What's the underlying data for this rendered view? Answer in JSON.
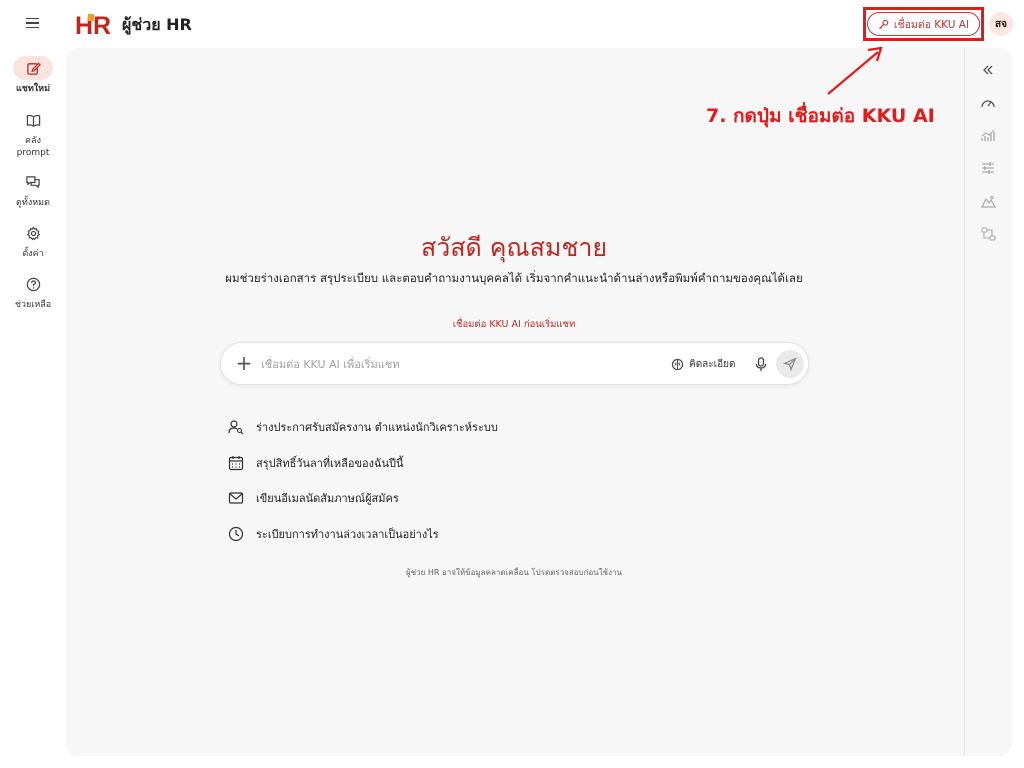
{
  "header": {
    "app_title": "ผู้ช่วย HR",
    "logo_text": "HR",
    "connect_button": "เชื่อมต่อ KKU AI",
    "avatar_initials": "สจ"
  },
  "sidebar": {
    "items": [
      {
        "label": "แชทใหม่",
        "icon": "edit-icon",
        "active": true
      },
      {
        "label": "คลัง prompt",
        "icon": "book-icon",
        "active": false
      },
      {
        "label": "ดูทั้งหมด",
        "icon": "chat-icon",
        "active": false
      },
      {
        "label": "ตั้งค่า",
        "icon": "gear-icon",
        "active": false
      },
      {
        "label": "ช่วยเหลือ",
        "icon": "help-icon",
        "active": false
      }
    ]
  },
  "right_rail": {
    "icons": [
      "collapse-icon",
      "gauge-icon",
      "chart-icon",
      "sliders-icon",
      "mountain-icon",
      "flow-icon"
    ]
  },
  "main": {
    "greeting": "สวัสดี คุณสมชาย",
    "subtitle": "ผมช่วยร่างเอกสาร สรุประเบียบ และตอบคำถามงานบุคคลได้ เริ่มจากคำแนะนำด้านล่างหรือพิมพ์คำถามของคุณได้เลย",
    "connect_hint": "เชื่อมต่อ KKU AI ก่อนเริ่มแชท",
    "input": {
      "placeholder": "เชื่อมต่อ KKU AI เพื่อเริ่มแชท",
      "value": "",
      "think_label": "คิดละเอียด"
    },
    "suggestions": [
      {
        "icon": "user-search-icon",
        "text": "ร่างประกาศรับสมัครงาน ตำแหน่งนักวิเคราะห์ระบบ"
      },
      {
        "icon": "calendar-icon",
        "text": "สรุปสิทธิ์วันลาที่เหลือของฉันปีนี้"
      },
      {
        "icon": "mail-icon",
        "text": "เขียนอีเมลนัดสัมภาษณ์ผู้สมัคร"
      },
      {
        "icon": "clock-icon",
        "text": "ระเบียบการทำงานล่วงเวลาเป็นอย่างไร"
      }
    ],
    "disclaimer": "ผู้ช่วย HR อาจให้ข้อมูลคลาดเคลื่อน โปรดตรวจสอบก่อนใช้งาน"
  },
  "annotation": {
    "text": "7. กดปุ่ม เชื่อมต่อ KKU AI",
    "color": "#e31b1b"
  },
  "colors": {
    "accent": "#c0261e",
    "active_bg": "#fbe3e0",
    "panel_bg": "#f7f7f7"
  }
}
